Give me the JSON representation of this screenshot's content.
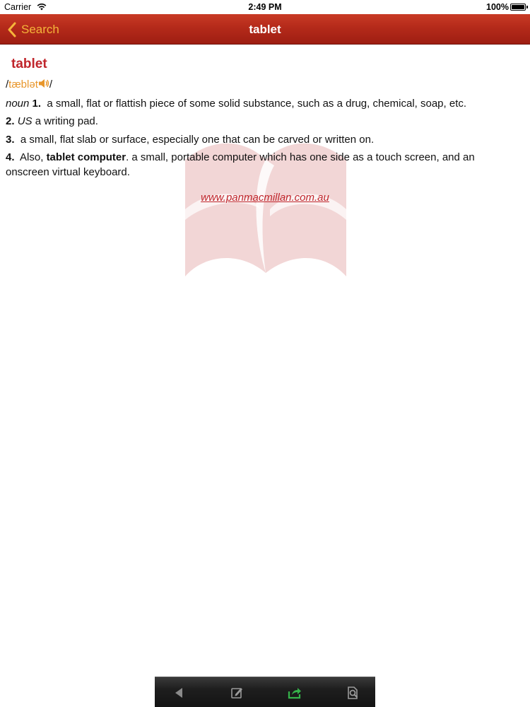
{
  "status_bar": {
    "carrier": "Carrier",
    "time": "2:49 PM",
    "battery": "100%"
  },
  "nav": {
    "back_label": "Search",
    "title": "tablet"
  },
  "entry": {
    "headword": "tablet",
    "pron_open": "/",
    "pronunciation": "tæblət",
    "pron_close": "/",
    "pos": "noun",
    "senses": [
      {
        "num": "1.",
        "text": "a small, flat or flattish piece of some solid substance, such as a drug, chemical, soap, etc."
      },
      {
        "num": "2.",
        "label": "US",
        "text": "a writing pad."
      },
      {
        "num": "3.",
        "text": "a small, flat slab or surface, especially one that can be carved or written on."
      },
      {
        "num": "4.",
        "pre": "Also,",
        "term": "tablet computer",
        "text": ". a small, portable computer which has one side as a touch screen, and an onscreen virtual keyboard."
      }
    ],
    "source_link": "www.panmacmillan.com.au"
  },
  "toolbar": {
    "icons": [
      "back-arrow-icon",
      "edit-note-icon",
      "share-icon",
      "zoom-icon"
    ]
  },
  "colors": {
    "nav_bar": "#b42a1a",
    "back_label": "#f5b53a",
    "headword": "#c0262c",
    "pronunciation": "#e8962a",
    "share_icon": "#35b34a"
  }
}
